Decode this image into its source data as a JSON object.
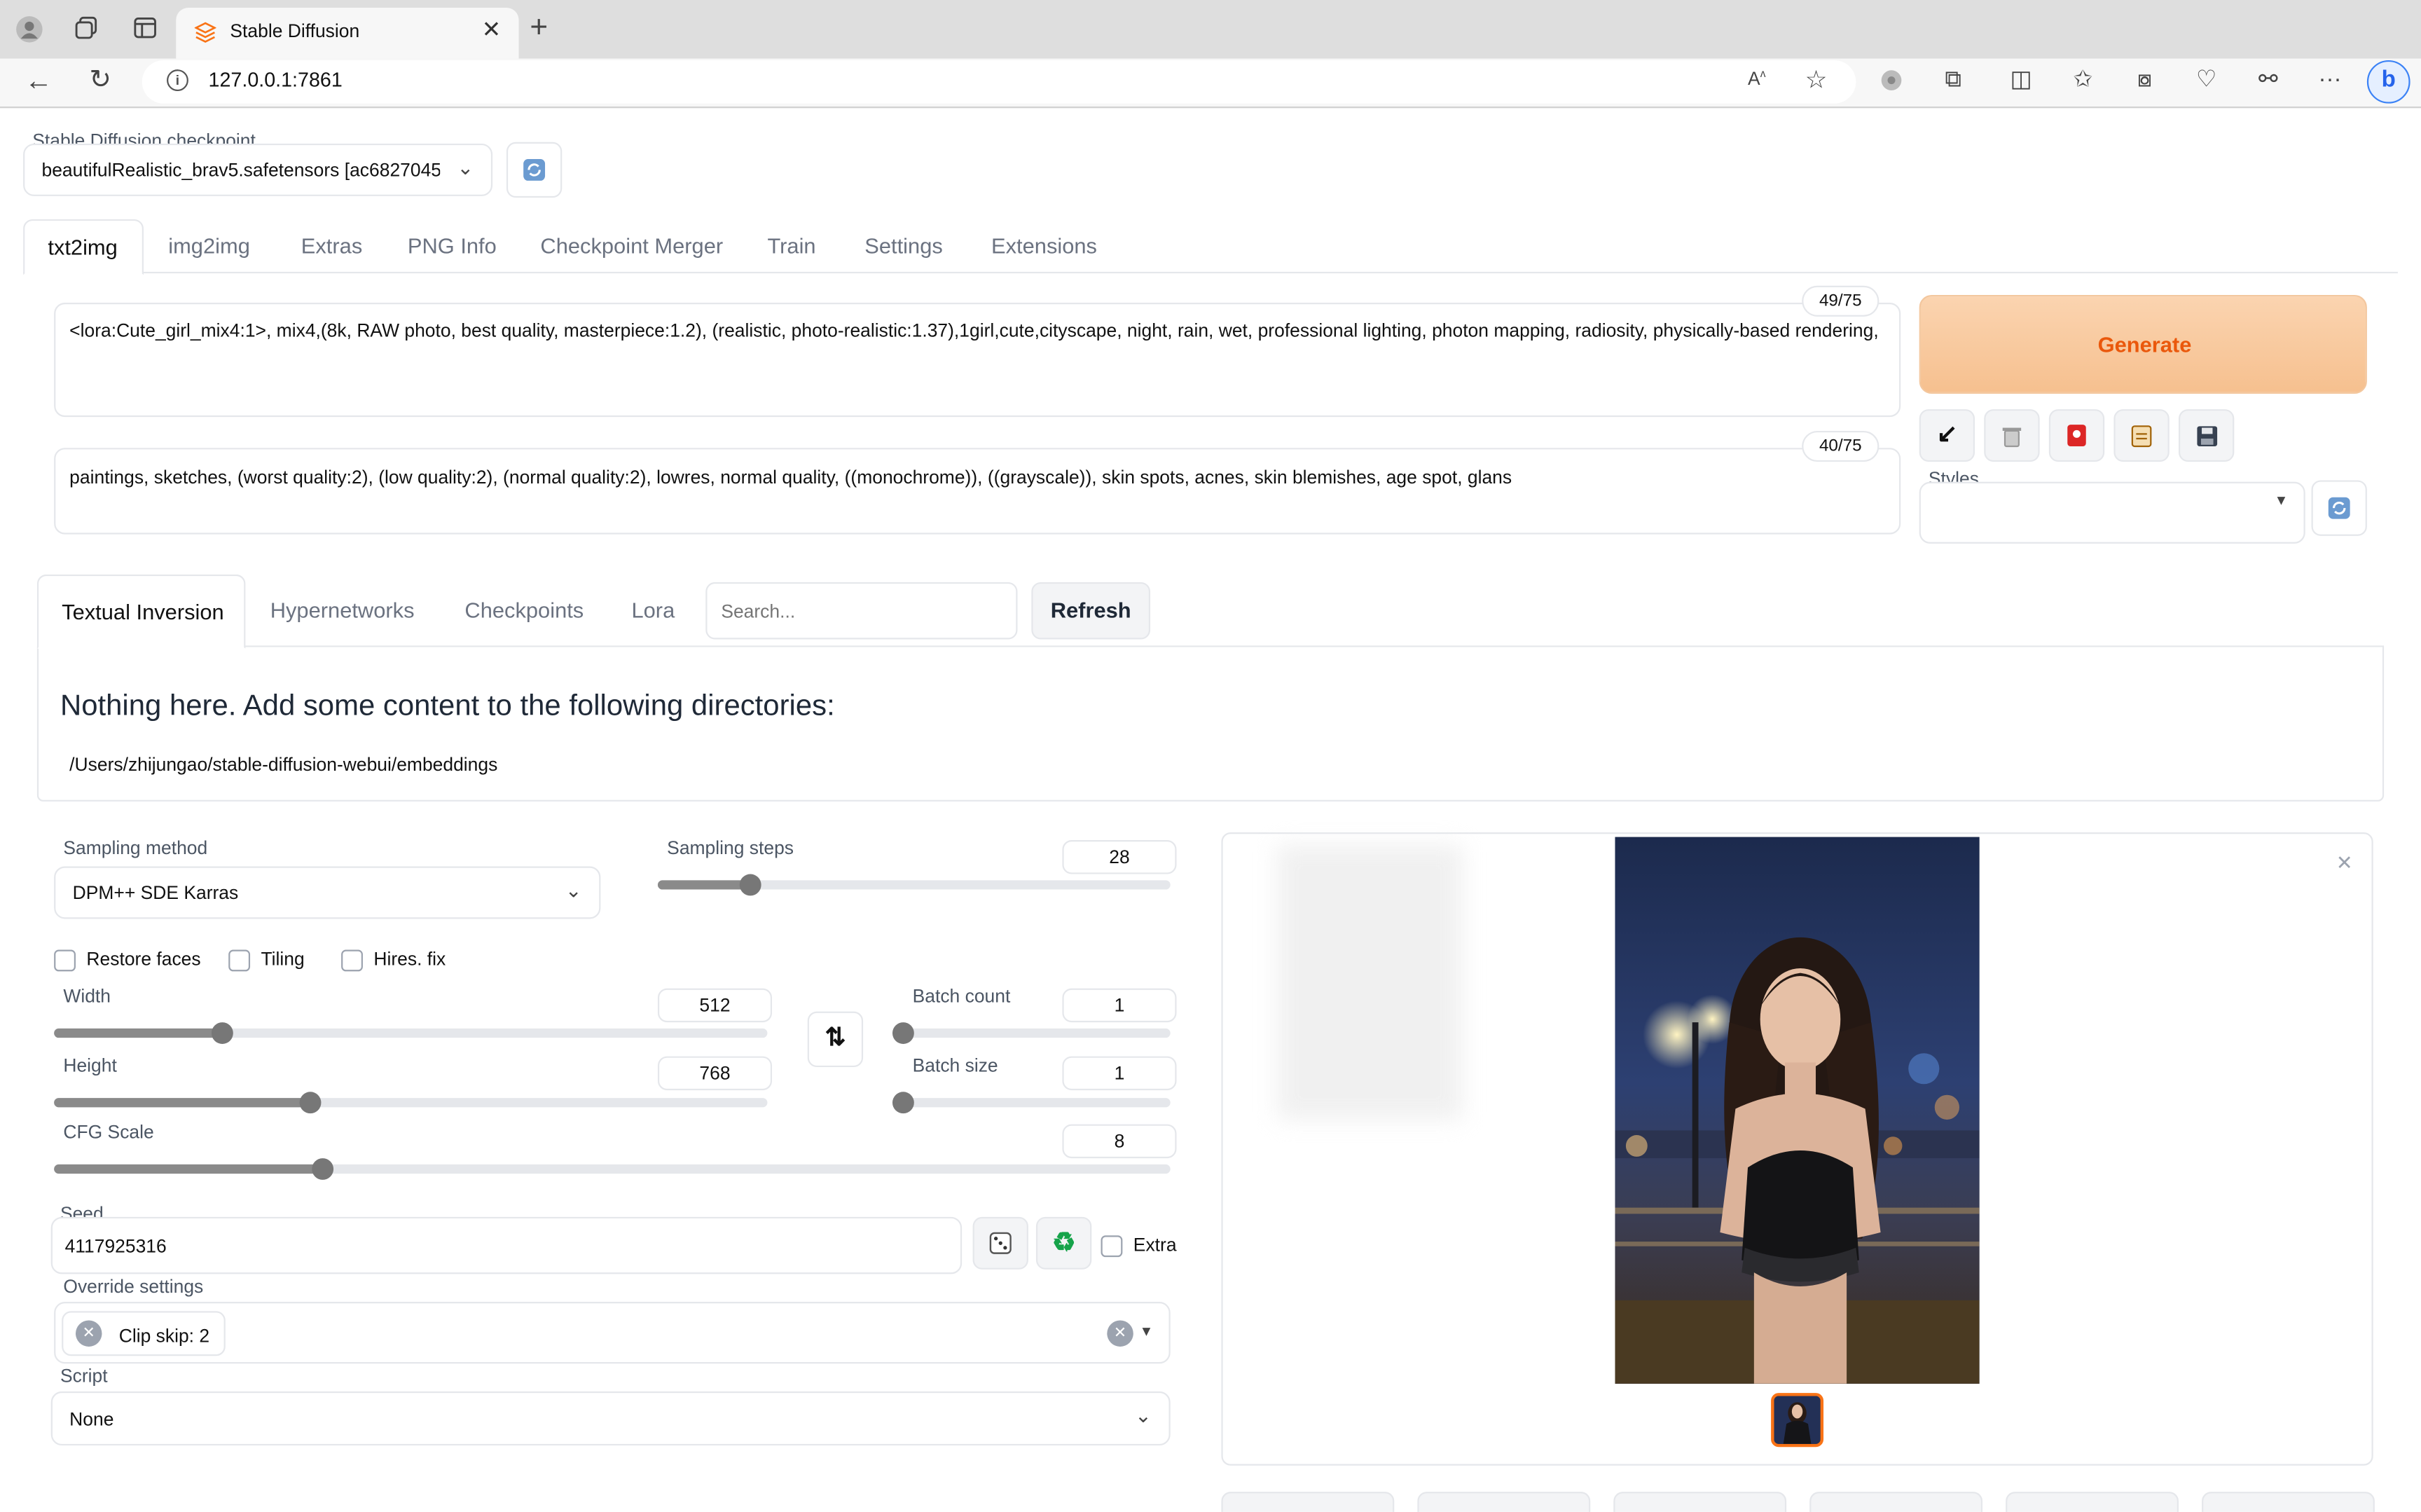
{
  "browser": {
    "tab_title": "Stable Diffusion",
    "url": "127.0.0.1:7861"
  },
  "checkpoint": {
    "label": "Stable Diffusion checkpoint",
    "value": "beautifulRealistic_brav5.safetensors [ac6827045"
  },
  "main_tabs": [
    "txt2img",
    "img2img",
    "Extras",
    "PNG Info",
    "Checkpoint Merger",
    "Train",
    "Settings",
    "Extensions"
  ],
  "prompt": {
    "counter": "49/75",
    "text": "<lora:Cute_girl_mix4:1>, mix4,(8k, RAW photo, best quality, masterpiece:1.2), (realistic, photo-realistic:1.37),1girl,cute,cityscape, night, rain, wet, professional lighting, photon mapping, radiosity, physically-based rendering,"
  },
  "negative_prompt": {
    "counter": "40/75",
    "text": "paintings, sketches, (worst quality:2), (low quality:2), (normal quality:2), lowres, normal quality, ((monochrome)), ((grayscale)), skin spots, acnes, skin blemishes, age spot, glans"
  },
  "generate_label": "Generate",
  "styles_label": "Styles",
  "extra_tabs": [
    "Textual Inversion",
    "Hypernetworks",
    "Checkpoints",
    "Lora"
  ],
  "extra_search_placeholder": "Search...",
  "refresh_label": "Refresh",
  "empty_message": "Nothing here. Add some content to the following directories:",
  "empty_path": "/Users/zhijungao/stable-diffusion-webui/embeddings",
  "sampling": {
    "method_label": "Sampling method",
    "method_value": "DPM++ SDE Karras",
    "steps_label": "Sampling steps",
    "steps_value": "28"
  },
  "checkboxes": {
    "restore_faces": "Restore faces",
    "tiling": "Tiling",
    "hires_fix": "Hires. fix",
    "extra": "Extra"
  },
  "width": {
    "label": "Width",
    "value": "512"
  },
  "height": {
    "label": "Height",
    "value": "768"
  },
  "batch_count": {
    "label": "Batch count",
    "value": "1"
  },
  "batch_size": {
    "label": "Batch size",
    "value": "1"
  },
  "cfg": {
    "label": "CFG Scale",
    "value": "8"
  },
  "seed": {
    "label": "Seed",
    "value": "4117925316"
  },
  "override": {
    "label": "Override settings",
    "chip": "Clip skip: 2"
  },
  "script": {
    "label": "Script",
    "value": "None"
  },
  "slider_levels": {
    "sampling_steps": 0.18,
    "width": 0.235,
    "height": 0.359,
    "batch_count": 0.0,
    "batch_size": 0.0,
    "cfg_scale": 0.241
  },
  "colors": {
    "generate_bg": "#f7c79c",
    "generate_text": "#ea580c",
    "slider_fill": "#8a8a8a",
    "recycle_icon": "#16a34a"
  },
  "icons": [
    "refresh-icon",
    "arrow-down-left-icon",
    "trash-icon",
    "red-card-icon",
    "clipboard-icon",
    "save-icon",
    "swap-icon",
    "dice-icon",
    "recycle-icon",
    "close-icon"
  ]
}
